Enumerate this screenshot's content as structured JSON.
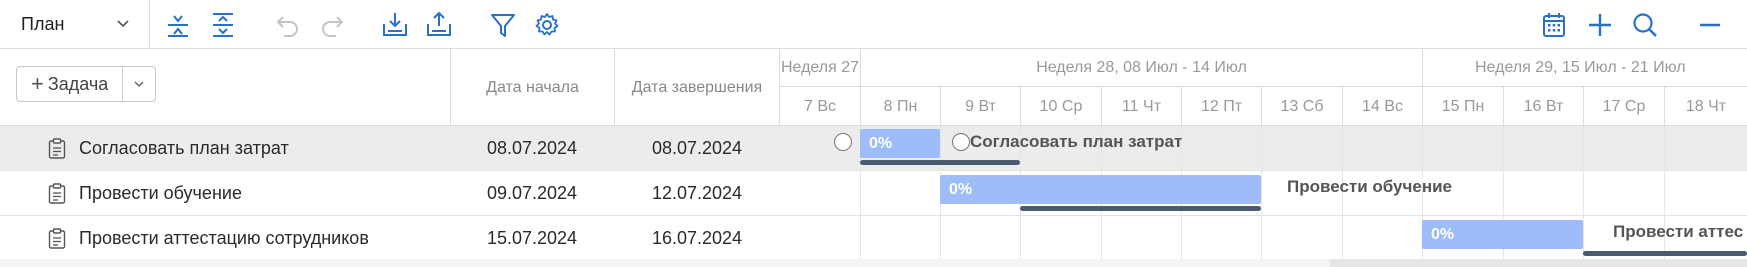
{
  "toolbar": {
    "view_label": "План",
    "icons": [
      "collapse-all-icon",
      "expand-all-icon",
      "undo-icon",
      "redo-icon",
      "download-icon",
      "upload-icon",
      "filter-icon",
      "settings-icon",
      "calendar-icon",
      "zoom-in-icon",
      "search-icon",
      "zoom-out-icon"
    ],
    "accent_color": "#2a6fc9",
    "disabled_color": "#c4c4c4"
  },
  "grid": {
    "add_task_label": "Задача",
    "columns": {
      "start": "Дата начала",
      "end": "Дата завершения"
    },
    "rows": [
      {
        "name": "Согласовать план затрат",
        "start": "08.07.2024",
        "end": "08.07.2024",
        "selected": true
      },
      {
        "name": "Провести обучение",
        "start": "09.07.2024",
        "end": "12.07.2024",
        "selected": false
      },
      {
        "name": "Провести аттестацию сотрудников",
        "start": "15.07.2024",
        "end": "16.07.2024",
        "selected": false
      }
    ]
  },
  "gantt": {
    "weeks": [
      {
        "label": "Неделя 27"
      },
      {
        "label": "Неделя 28, 08 Июл - 14 Июл"
      },
      {
        "label": "Неделя 29, 15 Июл - 21 Июл"
      }
    ],
    "days": [
      "7 Вс",
      "8 Пн",
      "9 Вт",
      "10 Ср",
      "11 Чт",
      "12 Пт",
      "13 Сб",
      "14 Вс",
      "15 Пн",
      "16 Вт",
      "17 Ср",
      "18 Чт"
    ],
    "bars": [
      {
        "progress": "0%",
        "label": "Согласовать план затрат"
      },
      {
        "progress": "0%",
        "label": "Провести обучение"
      },
      {
        "progress": "0%",
        "label": "Провести аттес"
      }
    ],
    "bar_color": "#9dbcf8"
  }
}
